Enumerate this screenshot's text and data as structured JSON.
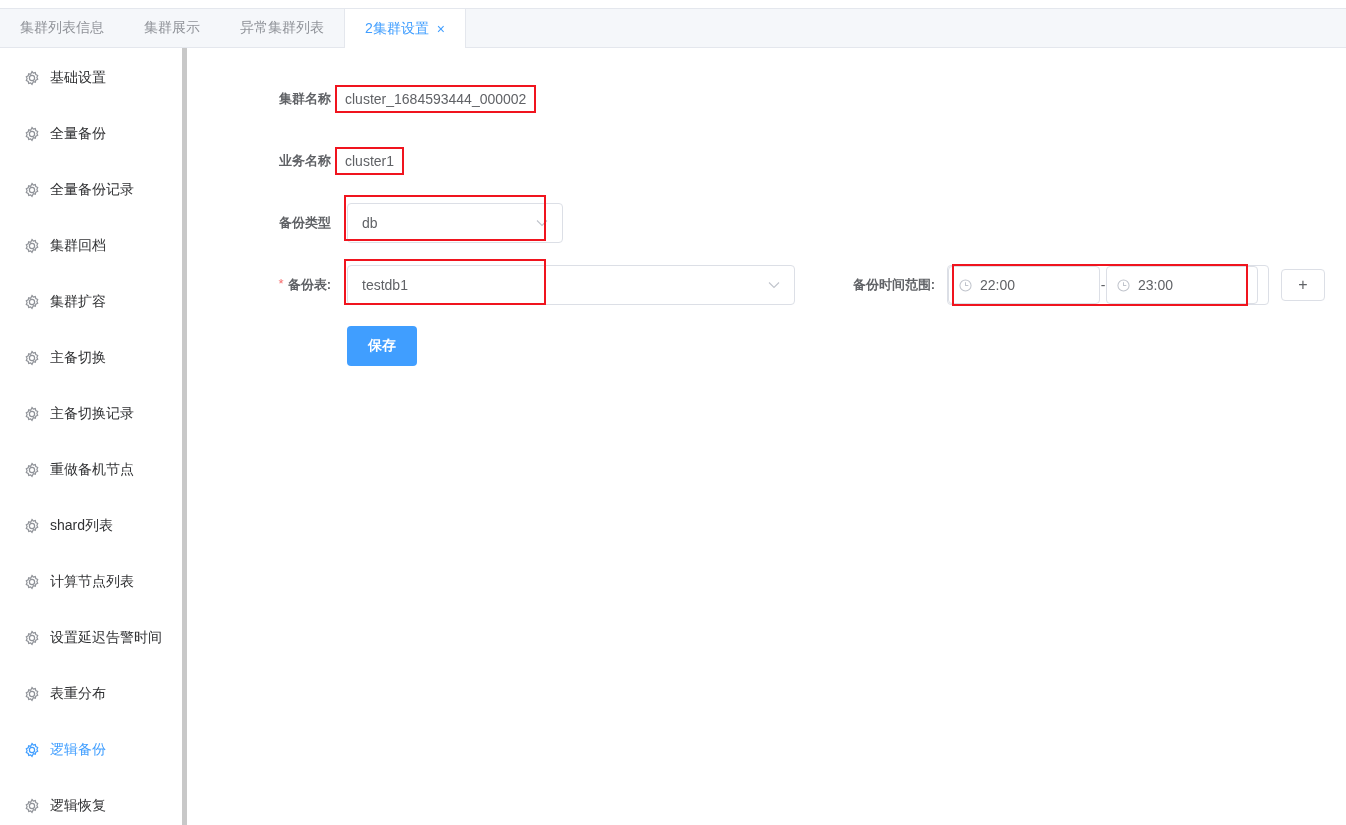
{
  "tabs": [
    {
      "label": "集群列表信息",
      "selected": false,
      "closable": false
    },
    {
      "label": "集群展示",
      "selected": false,
      "closable": false
    },
    {
      "label": "异常集群列表",
      "selected": false,
      "closable": false
    },
    {
      "label": "2集群设置",
      "selected": true,
      "closable": true,
      "close_glyph": "×"
    }
  ],
  "sidebar": {
    "items": [
      {
        "label": "基础设置",
        "selected": false
      },
      {
        "label": "全量备份",
        "selected": false
      },
      {
        "label": "全量备份记录",
        "selected": false
      },
      {
        "label": "集群回档",
        "selected": false
      },
      {
        "label": "集群扩容",
        "selected": false
      },
      {
        "label": "主备切换",
        "selected": false
      },
      {
        "label": "主备切换记录",
        "selected": false
      },
      {
        "label": "重做备机节点",
        "selected": false
      },
      {
        "label": "shard列表",
        "selected": false
      },
      {
        "label": "计算节点列表",
        "selected": false
      },
      {
        "label": "设置延迟告警时间",
        "selected": false
      },
      {
        "label": "表重分布",
        "selected": false
      },
      {
        "label": "逻辑备份",
        "selected": true
      },
      {
        "label": "逻辑恢复",
        "selected": false
      }
    ]
  },
  "form": {
    "fields": [
      {
        "kind": "text",
        "label": "集群名称",
        "value": "cluster_1684593444_000002",
        "highlighted": true,
        "required": false
      },
      {
        "kind": "text",
        "label": "业务名称",
        "value": "cluster1",
        "highlighted": true,
        "required": false
      },
      {
        "kind": "select",
        "label": "备份类型",
        "value": "db",
        "highlighted": true,
        "required": false
      },
      {
        "kind": "wide-select",
        "label": "备份表:",
        "value": "testdb1",
        "highlighted": true,
        "required": true,
        "required_mark": "*"
      }
    ],
    "time_range": {
      "label": "备份时间范围:",
      "start": "22:00",
      "separator": "-",
      "end": "23:00",
      "highlighted": true
    },
    "add_button": "+",
    "save_button": "保存"
  }
}
